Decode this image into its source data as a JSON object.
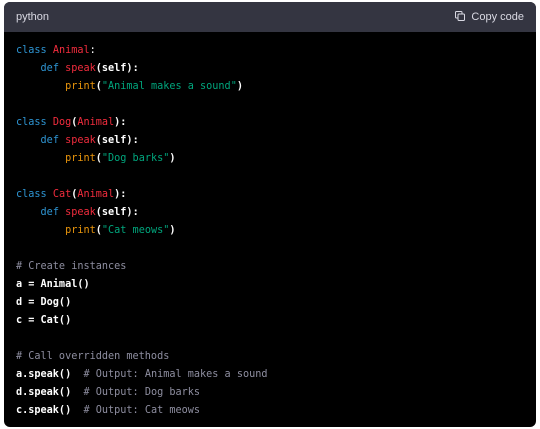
{
  "header": {
    "language": "python",
    "copy_label": "Copy code"
  },
  "code_lines": [
    [
      {
        "t": "kw",
        "v": "class "
      },
      {
        "t": "cls",
        "v": "Animal"
      },
      {
        "t": "plain",
        "v": ":"
      }
    ],
    [
      {
        "t": "plain",
        "v": "    "
      },
      {
        "t": "kw",
        "v": "def "
      },
      {
        "t": "fn",
        "v": "speak"
      },
      {
        "t": "ident",
        "v": "(self):"
      }
    ],
    [
      {
        "t": "plain",
        "v": "        "
      },
      {
        "t": "builtin",
        "v": "print"
      },
      {
        "t": "ident",
        "v": "("
      },
      {
        "t": "str",
        "v": "\"Animal makes a sound\""
      },
      {
        "t": "ident",
        "v": ")"
      }
    ],
    [],
    [
      {
        "t": "kw",
        "v": "class "
      },
      {
        "t": "cls",
        "v": "Dog"
      },
      {
        "t": "ident",
        "v": "("
      },
      {
        "t": "cls",
        "v": "Animal"
      },
      {
        "t": "ident",
        "v": "):"
      }
    ],
    [
      {
        "t": "plain",
        "v": "    "
      },
      {
        "t": "kw",
        "v": "def "
      },
      {
        "t": "fn",
        "v": "speak"
      },
      {
        "t": "ident",
        "v": "(self):"
      }
    ],
    [
      {
        "t": "plain",
        "v": "        "
      },
      {
        "t": "builtin",
        "v": "print"
      },
      {
        "t": "ident",
        "v": "("
      },
      {
        "t": "str",
        "v": "\"Dog barks\""
      },
      {
        "t": "ident",
        "v": ")"
      }
    ],
    [],
    [
      {
        "t": "kw",
        "v": "class "
      },
      {
        "t": "cls",
        "v": "Cat"
      },
      {
        "t": "ident",
        "v": "("
      },
      {
        "t": "cls",
        "v": "Animal"
      },
      {
        "t": "ident",
        "v": "):"
      }
    ],
    [
      {
        "t": "plain",
        "v": "    "
      },
      {
        "t": "kw",
        "v": "def "
      },
      {
        "t": "fn",
        "v": "speak"
      },
      {
        "t": "ident",
        "v": "(self):"
      }
    ],
    [
      {
        "t": "plain",
        "v": "        "
      },
      {
        "t": "builtin",
        "v": "print"
      },
      {
        "t": "ident",
        "v": "("
      },
      {
        "t": "str",
        "v": "\"Cat meows\""
      },
      {
        "t": "ident",
        "v": ")"
      }
    ],
    [],
    [
      {
        "t": "cmt",
        "v": "# Create instances"
      }
    ],
    [
      {
        "t": "ident",
        "v": "a = Animal()"
      }
    ],
    [
      {
        "t": "ident",
        "v": "d = Dog()"
      }
    ],
    [
      {
        "t": "ident",
        "v": "c = Cat()"
      }
    ],
    [],
    [
      {
        "t": "cmt",
        "v": "# Call overridden methods"
      }
    ],
    [
      {
        "t": "ident",
        "v": "a.speak()"
      },
      {
        "t": "plain",
        "v": "  "
      },
      {
        "t": "cmt",
        "v": "# Output: Animal makes a sound"
      }
    ],
    [
      {
        "t": "ident",
        "v": "d.speak()"
      },
      {
        "t": "plain",
        "v": "  "
      },
      {
        "t": "cmt",
        "v": "# Output: Dog barks"
      }
    ],
    [
      {
        "t": "ident",
        "v": "c.speak()"
      },
      {
        "t": "plain",
        "v": "  "
      },
      {
        "t": "cmt",
        "v": "# Output: Cat meows"
      }
    ]
  ],
  "colors": {
    "keyword": "#2e95d3",
    "class_name": "#f22c3d",
    "builtin": "#e9950c",
    "string": "#00a67d",
    "comment": "#8e8ea0",
    "background": "#000000",
    "header_background": "#343541"
  },
  "icons": {
    "copy": "clipboard-icon"
  }
}
